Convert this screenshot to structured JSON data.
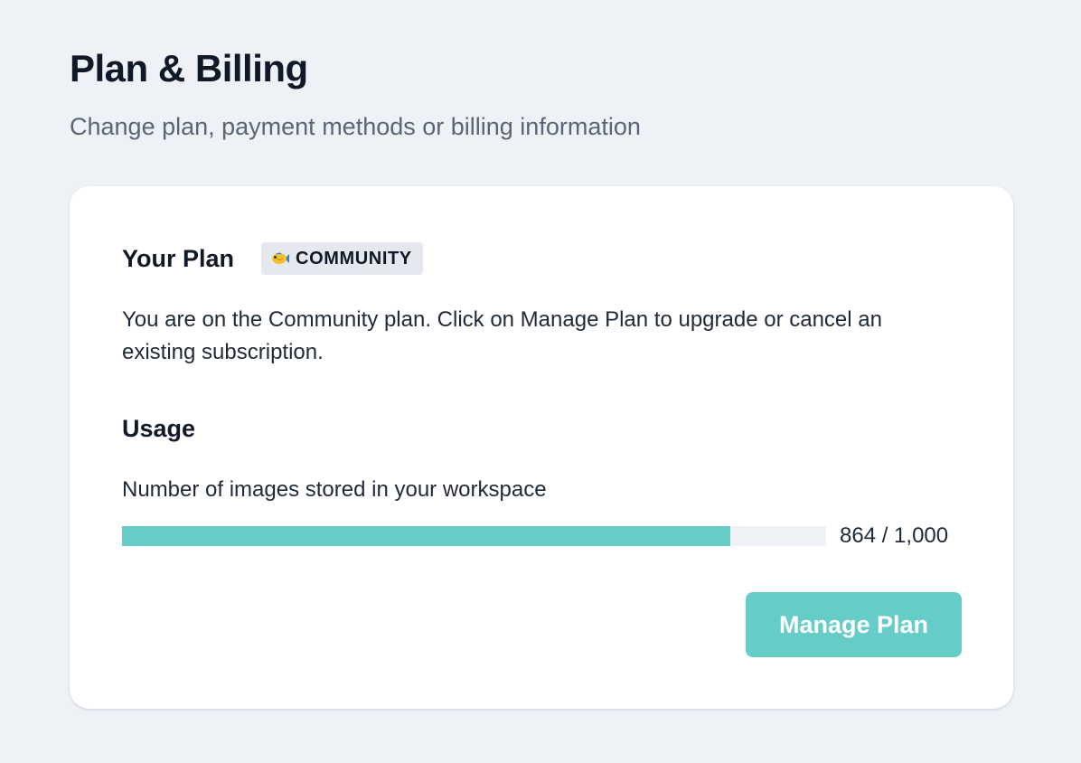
{
  "header": {
    "title": "Plan & Billing",
    "subtitle": "Change plan, payment methods or billing information"
  },
  "plan": {
    "heading": "Your Plan",
    "badge_icon": "fish-icon",
    "badge_label": "COMMUNITY",
    "description": "You are on the Community plan. Click on Manage Plan to upgrade or cancel an existing subscription."
  },
  "usage": {
    "heading": "Usage",
    "metric_label": "Number of images stored in your workspace",
    "used": 864,
    "limit": 1000,
    "count_text": "864 / 1,000"
  },
  "actions": {
    "manage_label": "Manage Plan"
  },
  "colors": {
    "accent": "#66ccc8",
    "page_background": "#eef1f6",
    "badge_background": "#e5e8ee"
  }
}
